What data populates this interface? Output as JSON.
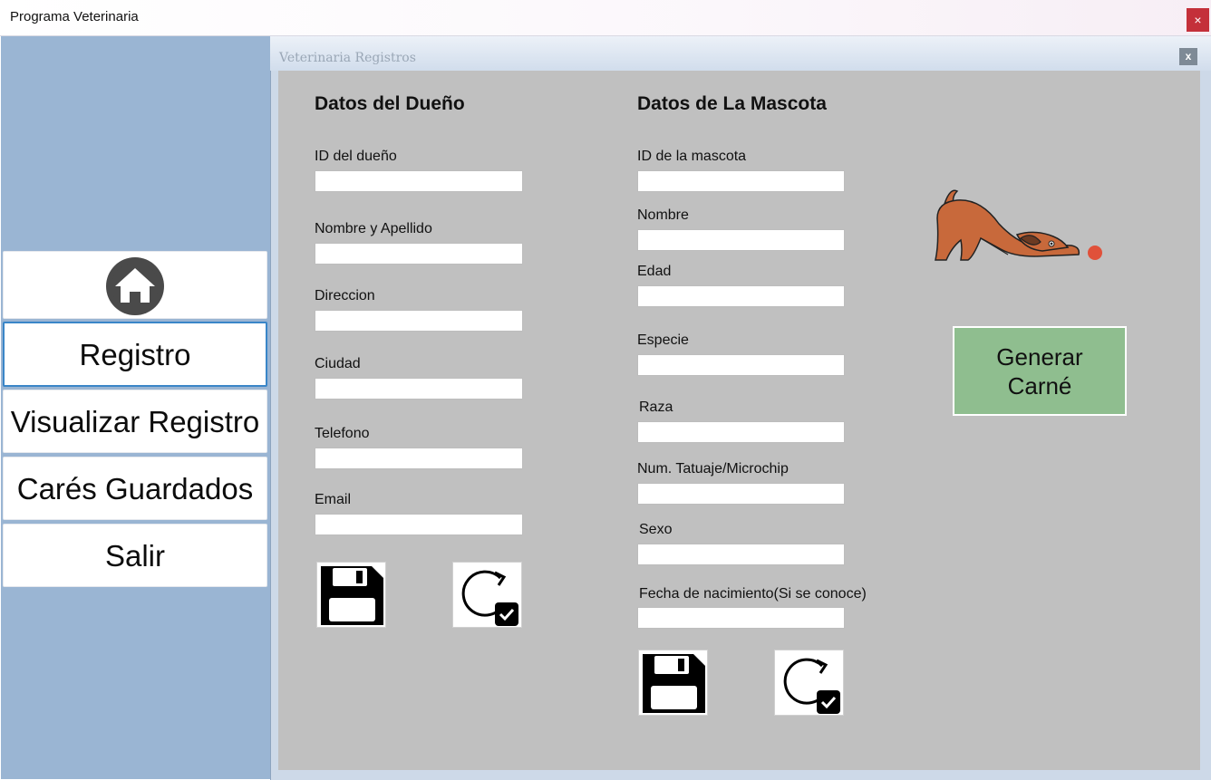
{
  "window": {
    "title": "Programa Veterinaria",
    "close_label": "×"
  },
  "sidebar": {
    "home_icon": "home-icon",
    "items": [
      {
        "label": "Registro"
      },
      {
        "label": "Visualizar Registro"
      },
      {
        "label": "Carés Guardados"
      },
      {
        "label": "Salir"
      }
    ]
  },
  "child_window": {
    "title": "Veterinaria Registros",
    "close_label": "x"
  },
  "owner": {
    "heading": "Datos del Dueño",
    "fields": [
      {
        "label": "ID del dueño",
        "value": ""
      },
      {
        "label": "Nombre y Apellido",
        "value": ""
      },
      {
        "label": "Direccion",
        "value": ""
      },
      {
        "label": "Ciudad",
        "value": ""
      },
      {
        "label": "Telefono",
        "value": ""
      },
      {
        "label": "Email",
        "value": ""
      }
    ],
    "save_icon": "floppy-disk-icon",
    "refresh_icon": "refresh-check-icon"
  },
  "pet": {
    "heading": "Datos de La Mascota",
    "fields": [
      {
        "label": "ID de la mascota",
        "value": ""
      },
      {
        "label": "Nombre",
        "value": ""
      },
      {
        "label": "Edad",
        "value": ""
      },
      {
        "label": "Especie",
        "value": ""
      },
      {
        "label": "Raza",
        "value": ""
      },
      {
        "label": "Num. Tatuaje/Microchip",
        "value": ""
      },
      {
        "label": "Sexo",
        "value": ""
      },
      {
        "label": "Fecha de nacimiento(Si se conoce)",
        "value": ""
      }
    ],
    "save_icon": "floppy-disk-icon",
    "refresh_icon": "refresh-check-icon"
  },
  "generate_button": {
    "line1": "Generar",
    "line2": "Carné"
  },
  "colors": {
    "sidebar_bg": "#9ab5d3",
    "form_bg": "#c0c0c0",
    "generate_bg": "#8fbe8f",
    "close_red": "#c4303a",
    "selected_border": "#3a86c8"
  }
}
